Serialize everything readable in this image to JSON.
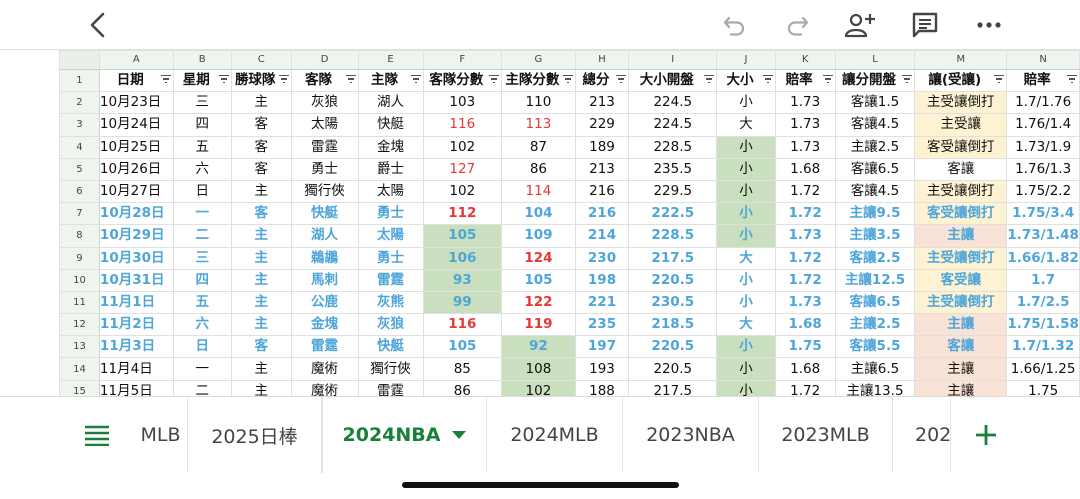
{
  "column_letters": [
    "A",
    "B",
    "C",
    "D",
    "E",
    "F",
    "G",
    "H",
    "I",
    "J",
    "K",
    "L",
    "M",
    "N"
  ],
  "header": {
    "row_number": "1",
    "cells": [
      "日期",
      "星期",
      "勝球隊",
      "客隊",
      "主隊",
      "客隊分數",
      "主隊分數",
      "總分",
      "大小開盤",
      "大小",
      "賠率",
      "讓分開盤",
      "讓(受讓)",
      "賠率"
    ]
  },
  "rows": [
    {
      "n": "2",
      "c": [
        "10月23日",
        "三",
        "主",
        "灰狼",
        "湖人",
        "103",
        "110",
        "213",
        "224.5",
        "小",
        "1.73",
        "客讓1.5",
        "主受讓倒打",
        "1.7/1.76"
      ]
    },
    {
      "n": "3",
      "c": [
        "10月24日",
        "四",
        "客",
        "太陽",
        "快艇",
        "116",
        "113",
        "229",
        "224.5",
        "大",
        "1.73",
        "客讓4.5",
        "主受讓",
        "1.76/1.4"
      ]
    },
    {
      "n": "4",
      "c": [
        "10月25日",
        "五",
        "客",
        "雷霆",
        "金塊",
        "102",
        "87",
        "189",
        "228.5",
        "小",
        "1.73",
        "主讓2.5",
        "客受讓倒打",
        "1.73/1.9"
      ]
    },
    {
      "n": "5",
      "c": [
        "10月26日",
        "六",
        "客",
        "勇士",
        "爵士",
        "127",
        "86",
        "213",
        "235.5",
        "小",
        "1.68",
        "客讓6.5",
        "客讓",
        "1.76/1.3"
      ]
    },
    {
      "n": "6",
      "c": [
        "10月27日",
        "日",
        "主",
        "獨行俠",
        "太陽",
        "102",
        "114",
        "216",
        "229.5",
        "小",
        "1.72",
        "客讓4.5",
        "主受讓倒打",
        "1.75/2.2"
      ]
    },
    {
      "n": "7",
      "c": [
        "10月28日",
        "一",
        "客",
        "快艇",
        "勇士",
        "112",
        "104",
        "216",
        "222.5",
        "小",
        "1.72",
        "主讓9.5",
        "客受讓倒打",
        "1.75/3.4"
      ]
    },
    {
      "n": "8",
      "c": [
        "10月29日",
        "二",
        "主",
        "湖人",
        "太陽",
        "105",
        "109",
        "214",
        "228.5",
        "小",
        "1.73",
        "主讓3.5",
        "主讓",
        "1.73/1.48"
      ]
    },
    {
      "n": "9",
      "c": [
        "10月30日",
        "三",
        "主",
        "鵜鶘",
        "勇士",
        "106",
        "124",
        "230",
        "217.5",
        "大",
        "1.72",
        "客讓2.5",
        "主受讓倒打",
        "1.66/1.82"
      ]
    },
    {
      "n": "10",
      "c": [
        "10月31日",
        "四",
        "主",
        "馬刺",
        "雷霆",
        "93",
        "105",
        "198",
        "220.5",
        "小",
        "1.72",
        "主讓12.5",
        "客受讓",
        "1.7"
      ]
    },
    {
      "n": "11",
      "c": [
        "11月1日",
        "五",
        "主",
        "公鹿",
        "灰熊",
        "99",
        "122",
        "221",
        "230.5",
        "小",
        "1.73",
        "客讓6.5",
        "主受讓倒打",
        "1.7/2.5"
      ]
    },
    {
      "n": "12",
      "c": [
        "11月2日",
        "六",
        "主",
        "金塊",
        "灰狼",
        "116",
        "119",
        "235",
        "218.5",
        "大",
        "1.68",
        "主讓2.5",
        "主讓",
        "1.75/1.58"
      ]
    },
    {
      "n": "13",
      "c": [
        "11月3日",
        "日",
        "客",
        "雷霆",
        "快艇",
        "105",
        "92",
        "197",
        "220.5",
        "小",
        "1.75",
        "客讓5.5",
        "客讓",
        "1.7/1.32"
      ]
    },
    {
      "n": "14",
      "c": [
        "11月4日",
        "一",
        "主",
        "魔術",
        "獨行俠",
        "85",
        "108",
        "193",
        "220.5",
        "小",
        "1.68",
        "主讓6.5",
        "主讓",
        "1.66/1.25"
      ]
    },
    {
      "n": "15",
      "c": [
        "11月5日",
        "二",
        "主",
        "魔術",
        "雷霆",
        "86",
        "102",
        "188",
        "217.5",
        "小",
        "1.72",
        "主讓13.5",
        "主讓",
        "1.75"
      ]
    }
  ],
  "sheet_tabs": [
    {
      "label": "MLB",
      "active": false
    },
    {
      "label": "2025日棒",
      "active": false
    },
    {
      "label": "2024NBA",
      "active": true
    },
    {
      "label": "2024MLB",
      "active": false
    },
    {
      "label": "2023NBA",
      "active": false
    },
    {
      "label": "2023MLB",
      "active": false
    },
    {
      "label": "202",
      "active": false
    }
  ],
  "colors": {
    "accent": "#188038",
    "blue": "#4ea5d9",
    "red": "#e53935",
    "green_fill": "#c9dfbd",
    "yellow_fill": "#fdf3d2",
    "peach_fill": "#f9e3d6"
  }
}
